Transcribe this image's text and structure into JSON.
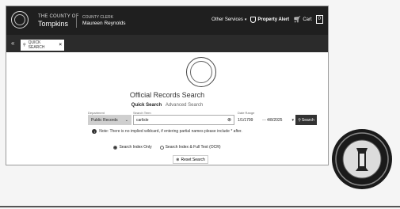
{
  "header": {
    "county_line1": "THE COUNTY OF",
    "county_line2": "Tompkins",
    "clerk_line1": "COUNTY CLERK",
    "clerk_line2": "Maureen Reynolds",
    "other_services": "Other Services",
    "property_alert": "Property Alert",
    "cart": "Cart",
    "cart_count": "0"
  },
  "tabs": [
    {
      "label": "QUICK SEARCH"
    }
  ],
  "search": {
    "title": "Official Records Search",
    "tab_quick": "Quick Search",
    "tab_advanced": "Advanced Search",
    "department_label": "Department",
    "department_value": "Public Records",
    "term_label": "Search Term",
    "term_value": "carlisle",
    "date_label": "Date Range",
    "date_from": "1/1/1799",
    "date_to": "4/8/2025",
    "search_button": "Search",
    "note": "Note: There is no implied wildcard, if entering partial names please include * after.",
    "radio_index": "Search Index Only",
    "radio_fulltext": "Search Index & Full Text (OCR)",
    "reset_button": "Reset Search"
  },
  "colors": {
    "header_bg": "#1f1f1f",
    "tabbar_bg": "#2b2b2b",
    "button_bg": "#333333"
  }
}
